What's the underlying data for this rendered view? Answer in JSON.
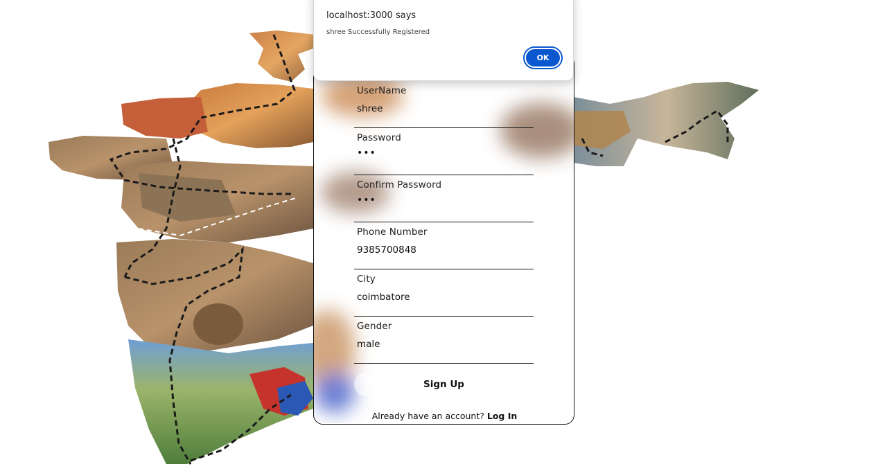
{
  "dialog": {
    "title": "localhost:3000 says",
    "message": "shree Successfully Registered",
    "ok_label": "OK"
  },
  "form": {
    "fields": [
      {
        "label": "UserName",
        "value": "shree"
      },
      {
        "label": "Password",
        "value": "•••"
      },
      {
        "label": "Confirm Password",
        "value": "•••"
      },
      {
        "label": "Phone Number",
        "value": "9385700848"
      },
      {
        "label": "City",
        "value": "coimbatore"
      },
      {
        "label": "Gender",
        "value": "male"
      }
    ],
    "signup_label": "Sign Up",
    "footer_text": "Already have an account?",
    "login_label": "Log In"
  },
  "colors": {
    "accent": "#0b57d0",
    "card_border": "#111111"
  }
}
